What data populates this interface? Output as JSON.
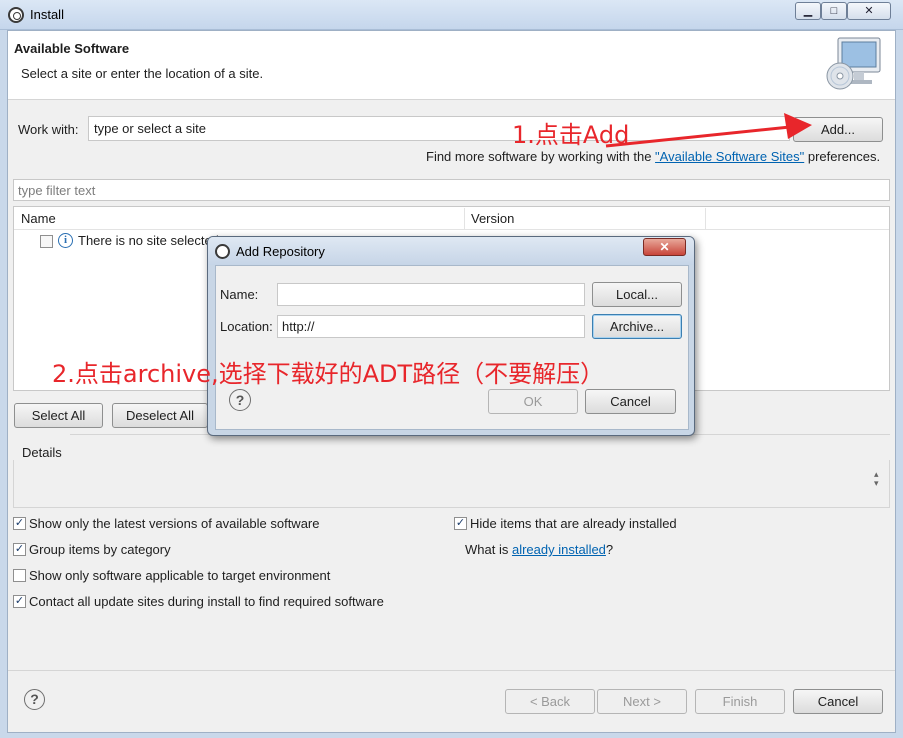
{
  "window": {
    "title": "Install",
    "controls": {
      "minimize": "▁",
      "maximize": "□",
      "close": "✕"
    }
  },
  "banner": {
    "title": "Available Software",
    "description": "Select a site or enter the location of a site.",
    "icon": "computer-cd-icon"
  },
  "work_with": {
    "label": "Work with:",
    "value": "type or select a site",
    "add_button": "Add...",
    "find_more_prefix": "Find more software by working with the ",
    "find_more_link": "\"Available Software Sites\"",
    "find_more_suffix": " preferences."
  },
  "filter": {
    "placeholder": "type filter text"
  },
  "table": {
    "columns": [
      "Name",
      "Version"
    ],
    "rows": [
      {
        "text": "There is no site selected.",
        "icon": "info-icon",
        "checked": false
      }
    ]
  },
  "buttons": {
    "select_all": "Select All",
    "deselect_all": "Deselect All"
  },
  "details": {
    "label": "Details",
    "spinner": "▴\n▾"
  },
  "options": [
    {
      "label": "Show only the latest versions of available software",
      "checked": true
    },
    {
      "label": "Group items by category",
      "checked": true
    },
    {
      "label": "Show only software applicable to target environment",
      "checked": false
    },
    {
      "label": "Contact all update sites during install to find required software",
      "checked": true
    },
    {
      "label": "Hide items that are already installed",
      "checked": true
    }
  ],
  "already_installed": {
    "prefix": "What is ",
    "link": "already installed",
    "suffix": "?"
  },
  "footer": {
    "help": "?",
    "back": "< Back",
    "next": "Next >",
    "finish": "Finish",
    "cancel": "Cancel"
  },
  "dialog": {
    "title": "Add Repository",
    "close": "✕",
    "name_label": "Name:",
    "name_value": "",
    "local_button": "Local...",
    "location_label": "Location:",
    "location_value": "http://",
    "archive_button": "Archive...",
    "help": "?",
    "ok_button": "OK",
    "cancel_button": "Cancel"
  },
  "annotations": {
    "step1": "1.点击Add",
    "step2": "2.点击archive,选择下载好的ADT路径（不要解压）",
    "color": "#e8262b"
  }
}
